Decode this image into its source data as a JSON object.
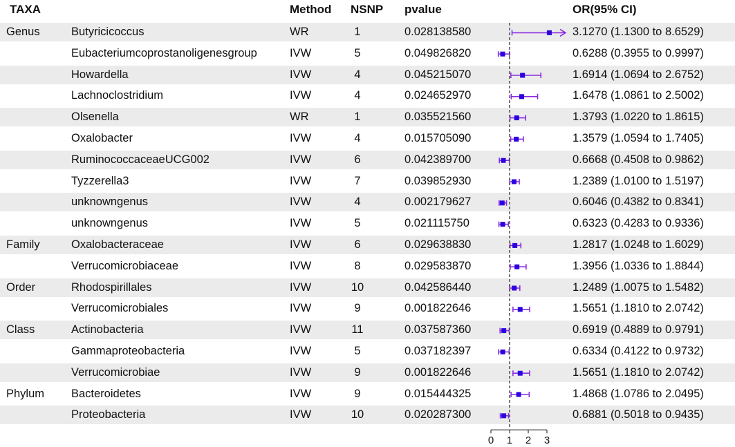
{
  "headers": {
    "taxa": "TAXA",
    "method": "Method",
    "nsnp": "NSNP",
    "pvalue": "pvalue",
    "or": "OR(95% CI)"
  },
  "colors": {
    "marker": "#2b00e0",
    "errorbar": "#8a2be2",
    "band": "#ebebeb"
  },
  "chart_data": {
    "type": "forest",
    "reference_line": 1,
    "xlim": [
      0,
      3.2
    ],
    "xticks": [
      0,
      1,
      2,
      3
    ],
    "rows": [
      {
        "level": "Genus",
        "taxon": "Butyricicoccus",
        "method": "WR",
        "nsnp": "1",
        "pvalue": "0.028138580",
        "or": 3.127,
        "lo": 1.13,
        "hi": 8.6529,
        "or_text": "3.1270 (1.1300 to 8.6529)"
      },
      {
        "level": "",
        "taxon": "Eubacteriumcoprostanoligenesgroup",
        "method": "IVW",
        "nsnp": "5",
        "pvalue": "0.049826820",
        "or": 0.6288,
        "lo": 0.3955,
        "hi": 0.9997,
        "or_text": "0.6288 (0.3955 to 0.9997)"
      },
      {
        "level": "",
        "taxon": "Howardella",
        "method": "IVW",
        "nsnp": "4",
        "pvalue": "0.045215070",
        "or": 1.6914,
        "lo": 1.0694,
        "hi": 2.6752,
        "or_text": "1.6914 (1.0694 to 2.6752)"
      },
      {
        "level": "",
        "taxon": "Lachnoclostridium",
        "method": "IVW",
        "nsnp": "4",
        "pvalue": "0.024652970",
        "or": 1.6478,
        "lo": 1.0861,
        "hi": 2.5002,
        "or_text": "1.6478 (1.0861 to 2.5002)"
      },
      {
        "level": "",
        "taxon": "Olsenella",
        "method": "WR",
        "nsnp": "1",
        "pvalue": "0.035521560",
        "or": 1.3793,
        "lo": 1.022,
        "hi": 1.8615,
        "or_text": "1.3793 (1.0220 to 1.8615)"
      },
      {
        "level": "",
        "taxon": "Oxalobacter",
        "method": "IVW",
        "nsnp": "4",
        "pvalue": "0.015705090",
        "or": 1.3579,
        "lo": 1.0594,
        "hi": 1.7405,
        "or_text": "1.3579 (1.0594 to 1.7405)"
      },
      {
        "level": "",
        "taxon": "RuminococcaceaeUCG002",
        "method": "IVW",
        "nsnp": "6",
        "pvalue": "0.042389700",
        "or": 0.6668,
        "lo": 0.4508,
        "hi": 0.9862,
        "or_text": "0.6668 (0.4508 to 0.9862)"
      },
      {
        "level": "",
        "taxon": "Tyzzerella3",
        "method": "IVW",
        "nsnp": "7",
        "pvalue": "0.039852930",
        "or": 1.2389,
        "lo": 1.01,
        "hi": 1.5197,
        "or_text": "1.2389 (1.0100 to 1.5197)"
      },
      {
        "level": "",
        "taxon": "unknowngenus",
        "method": "IVW",
        "nsnp": "4",
        "pvalue": "0.002179627",
        "or": 0.6046,
        "lo": 0.4382,
        "hi": 0.8341,
        "or_text": "0.6046 (0.4382 to 0.8341)"
      },
      {
        "level": "",
        "taxon": "unknowngenus",
        "method": "IVW",
        "nsnp": "5",
        "pvalue": "0.021115750",
        "or": 0.6323,
        "lo": 0.4283,
        "hi": 0.9336,
        "or_text": "0.6323 (0.4283 to 0.9336)"
      },
      {
        "level": "Family",
        "taxon": "Oxalobacteraceae",
        "method": "IVW",
        "nsnp": "6",
        "pvalue": "0.029638830",
        "or": 1.2817,
        "lo": 1.0248,
        "hi": 1.6029,
        "or_text": "1.2817 (1.0248 to 1.6029)"
      },
      {
        "level": "",
        "taxon": "Verrucomicrobiaceae",
        "method": "IVW",
        "nsnp": "8",
        "pvalue": "0.029583870",
        "or": 1.3956,
        "lo": 1.0336,
        "hi": 1.8844,
        "or_text": "1.3956 (1.0336 to 1.8844)"
      },
      {
        "level": "Order",
        "taxon": "Rhodospirillales",
        "method": "IVW",
        "nsnp": "10",
        "pvalue": "0.042586440",
        "or": 1.2489,
        "lo": 1.0075,
        "hi": 1.5482,
        "or_text": "1.2489 (1.0075 to 1.5482)"
      },
      {
        "level": "",
        "taxon": "Verrucomicrobiales",
        "method": "IVW",
        "nsnp": "9",
        "pvalue": "0.001822646",
        "or": 1.5651,
        "lo": 1.181,
        "hi": 2.0742,
        "or_text": "1.5651 (1.1810 to 2.0742)"
      },
      {
        "level": "Class",
        "taxon": "Actinobacteria",
        "method": "IVW",
        "nsnp": "11",
        "pvalue": "0.037587360",
        "or": 0.6919,
        "lo": 0.4889,
        "hi": 0.9791,
        "or_text": "0.6919 (0.4889 to 0.9791)"
      },
      {
        "level": "",
        "taxon": "Gammaproteobacteria",
        "method": "IVW",
        "nsnp": "5",
        "pvalue": "0.037182397",
        "or": 0.6334,
        "lo": 0.4122,
        "hi": 0.9732,
        "or_text": "0.6334 (0.4122 to 0.9732)"
      },
      {
        "level": "",
        "taxon": "Verrucomicrobiae",
        "method": "IVW",
        "nsnp": "9",
        "pvalue": "0.001822646",
        "or": 1.5651,
        "lo": 1.181,
        "hi": 2.0742,
        "or_text": "1.5651 (1.1810 to 2.0742)"
      },
      {
        "level": "Phylum",
        "taxon": "Bacteroidetes",
        "method": "IVW",
        "nsnp": "9",
        "pvalue": "0.015444325",
        "or": 1.4868,
        "lo": 1.0786,
        "hi": 2.0495,
        "or_text": "1.4868 (1.0786 to 2.0495)"
      },
      {
        "level": "",
        "taxon": "Proteobacteria",
        "method": "IVW",
        "nsnp": "10",
        "pvalue": "0.020287300",
        "or": 0.6881,
        "lo": 0.5018,
        "hi": 0.9435,
        "or_text": "0.6881 (0.5018 to 0.9435)"
      }
    ]
  }
}
